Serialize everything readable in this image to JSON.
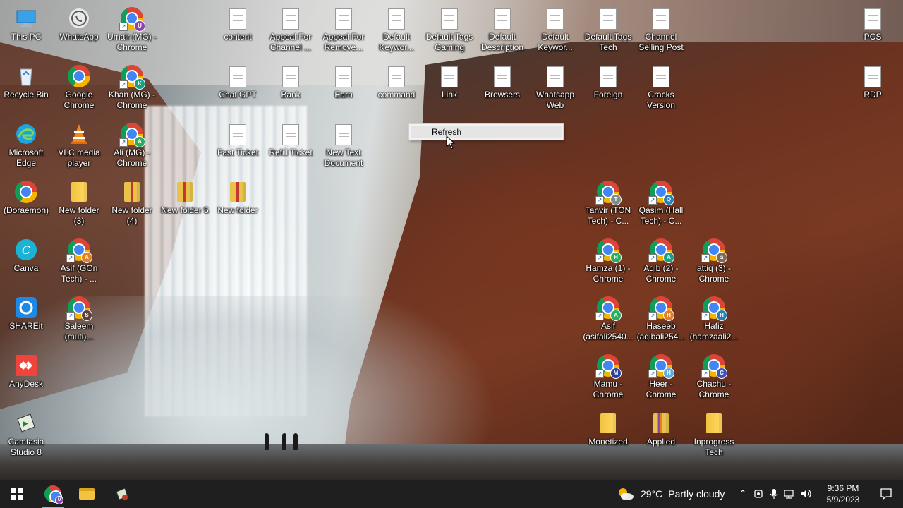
{
  "desktop": {
    "icons": [
      {
        "id": "this-pc",
        "label": "This PC",
        "kind": "pc"
      },
      {
        "id": "whatsapp",
        "label": "WhatsApp",
        "kind": "whatsapp"
      },
      {
        "id": "umair",
        "label": "Umair (MG) -\nChrome",
        "kind": "chrome",
        "badge": "U",
        "badge_color": "#8e44ad"
      },
      {
        "id": "content",
        "label": "content",
        "kind": "doc"
      },
      {
        "id": "appeal-channel",
        "label": "Appeal For\nChannel ...",
        "kind": "doc"
      },
      {
        "id": "appeal-remove",
        "label": "Appeal For\nRemove...",
        "kind": "doc"
      },
      {
        "id": "default-keyword-1",
        "label": "Default\nKeywor...",
        "kind": "doc"
      },
      {
        "id": "default-tags-gaming",
        "label": "Default Tags\nGaming",
        "kind": "doc"
      },
      {
        "id": "default-description",
        "label": "Default\nDescription",
        "kind": "doc"
      },
      {
        "id": "default-keyword-2",
        "label": "Default\nKeywor...",
        "kind": "doc"
      },
      {
        "id": "default-tags-tech",
        "label": "Default Tags\nTech",
        "kind": "doc"
      },
      {
        "id": "channel-selling",
        "label": "Channel\nSelling Post",
        "kind": "doc"
      },
      {
        "id": "pcs",
        "label": "PCS",
        "kind": "doc"
      },
      {
        "id": "recycle-bin",
        "label": "Recycle Bin",
        "kind": "bin"
      },
      {
        "id": "google-chrome",
        "label": "Google\nChrome",
        "kind": "chrome"
      },
      {
        "id": "khan",
        "label": "Khan (MG) -\nChrome",
        "kind": "chrome",
        "badge": "K",
        "badge_color": "#16a085"
      },
      {
        "id": "chat-gpt",
        "label": "Chat GPT",
        "kind": "doc"
      },
      {
        "id": "bank",
        "label": "Bank",
        "kind": "doc"
      },
      {
        "id": "earn",
        "label": "Earn",
        "kind": "doc"
      },
      {
        "id": "command",
        "label": "command",
        "kind": "doc"
      },
      {
        "id": "link",
        "label": "Link",
        "kind": "doc"
      },
      {
        "id": "browsers",
        "label": "Browsers",
        "kind": "doc"
      },
      {
        "id": "whatsapp-web",
        "label": "Whatsapp\nWeb",
        "kind": "doc"
      },
      {
        "id": "foreign",
        "label": "Foreign",
        "kind": "doc"
      },
      {
        "id": "cracks-version",
        "label": "Cracks\nVersion",
        "kind": "doc"
      },
      {
        "id": "rdp",
        "label": "RDP",
        "kind": "doc"
      },
      {
        "id": "edge",
        "label": "Microsoft\nEdge",
        "kind": "edge"
      },
      {
        "id": "vlc",
        "label": "VLC media\nplayer",
        "kind": "vlc"
      },
      {
        "id": "ali",
        "label": "Ali (MG) -\nChrome",
        "kind": "chrome",
        "badge": "A",
        "badge_color": "#27ae60"
      },
      {
        "id": "fast-ticket",
        "label": "Fast Ticket",
        "kind": "doc"
      },
      {
        "id": "refill-ticket",
        "label": "Refill Ticket",
        "kind": "doc"
      },
      {
        "id": "new-text-doc",
        "label": "New Text\nDocument",
        "kind": "doc"
      },
      {
        "id": "doraemon",
        "label": "(Doraemon)",
        "kind": "chrome"
      },
      {
        "id": "new-folder-3",
        "label": "New folder\n(3)",
        "kind": "folder"
      },
      {
        "id": "new-folder-4",
        "label": "New folder\n(4)",
        "kind": "folder-red"
      },
      {
        "id": "new-folder-5",
        "label": "New folder 5",
        "kind": "folder-red"
      },
      {
        "id": "new-folder",
        "label": "New folder",
        "kind": "folder-red"
      },
      {
        "id": "tanvir",
        "label": "Tanvir (TON\nTech) - C...",
        "kind": "chrome",
        "badge": "T",
        "badge_color": "#7f8c8d"
      },
      {
        "id": "qasim",
        "label": "Qasim (Hall\nTech) - C...",
        "kind": "chrome",
        "badge": "Q",
        "badge_color": "#2980b9"
      },
      {
        "id": "canva",
        "label": "Canva",
        "kind": "canva"
      },
      {
        "id": "asif-gon",
        "label": "Asif (GOn\nTech) - ...",
        "kind": "chrome",
        "badge": "A",
        "badge_color": "#e67e22"
      },
      {
        "id": "hamza",
        "label": "Hamza (1) -\nChrome",
        "kind": "chrome",
        "badge": "H",
        "badge_color": "#27ae60"
      },
      {
        "id": "aqib",
        "label": "Aqib (2) -\nChrome",
        "kind": "chrome",
        "badge": "A",
        "badge_color": "#16a085"
      },
      {
        "id": "attiq",
        "label": "attiq (3) -\nChrome",
        "kind": "chrome",
        "badge": "a",
        "badge_color": "#7f6a5a"
      },
      {
        "id": "shareit",
        "label": "SHAREit",
        "kind": "shareit"
      },
      {
        "id": "saleem",
        "label": "Saleem\n(muti)...",
        "kind": "chrome",
        "badge": "S",
        "badge_color": "#5d4037"
      },
      {
        "id": "asif",
        "label": "Asif\n(asifali2540...",
        "kind": "chrome",
        "badge": "A",
        "badge_color": "#27ae60"
      },
      {
        "id": "haseeb",
        "label": "Haseeb\n(aqibali254...",
        "kind": "chrome",
        "badge": "H",
        "badge_color": "#e67e22"
      },
      {
        "id": "hafiz",
        "label": "Hafiz\n(hamzaali2...",
        "kind": "chrome",
        "badge": "H",
        "badge_color": "#2980b9"
      },
      {
        "id": "anydesk",
        "label": "AnyDesk",
        "kind": "anydesk"
      },
      {
        "id": "mamu",
        "label": "Mamu -\nChrome",
        "kind": "chrome",
        "badge": "M",
        "badge_color": "#2c3e9e"
      },
      {
        "id": "heer",
        "label": "Heer -\nChrome",
        "kind": "chrome",
        "badge": "H",
        "badge_color": "#5dade2"
      },
      {
        "id": "chachu",
        "label": "Chachu -\nChrome",
        "kind": "chrome",
        "badge": "C",
        "badge_color": "#3f51b5"
      },
      {
        "id": "camtasia",
        "label": "Camtasia\nStudio 8",
        "kind": "camtasia"
      },
      {
        "id": "monetized",
        "label": "Monetized",
        "kind": "folder"
      },
      {
        "id": "applied",
        "label": "Applied",
        "kind": "folder-multi"
      },
      {
        "id": "inprogress-tech",
        "label": "Inprogress\nTech",
        "kind": "folder"
      }
    ]
  },
  "context_menu": {
    "items": [
      {
        "label": "Refresh"
      }
    ]
  },
  "taskbar": {
    "pinned": [
      {
        "id": "start",
        "icon": "windows-icon"
      },
      {
        "id": "chrome",
        "icon": "chrome-icon",
        "active": true
      },
      {
        "id": "explorer",
        "icon": "folder-icon"
      },
      {
        "id": "app3",
        "icon": "app-icon"
      }
    ],
    "weather": {
      "temp": "29°C",
      "condition": "Partly cloudy",
      "icon": "partly-cloudy-icon"
    },
    "clock": {
      "time": "9:36 PM",
      "date": "5/9/2023"
    }
  }
}
